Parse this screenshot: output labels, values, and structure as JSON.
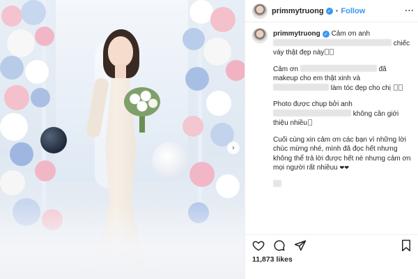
{
  "post": {
    "username": "primmytruong",
    "follow_label": "Follow",
    "dot": "•",
    "more": "···",
    "likes": "11,873 likes"
  },
  "caption": {
    "p1_a": "Cảm ơn anh",
    "p1_b": "chiếc váy thật đẹp này",
    "p2_a": "Cảm ơn",
    "p2_b": "đã makeup cho em thật xinh và",
    "p2_c": "làm tóc đẹp cho chị",
    "p3_a": "Photo được chụp bởi anh",
    "p3_b": "không cần giới thiệu nhiều",
    "p4": "Cuối cùng xin cảm ơn các bạn vì những lời chúc mừng nhé, mình đã đọc hết nhưng không thể trả lời được hết nè nhưng cảm ơn mọi người rất nhiềuu",
    "hearts": "❤❤"
  },
  "icons": {
    "verified": "verified-badge-icon",
    "like": "heart-icon",
    "comment": "comment-icon",
    "share": "share-icon",
    "save": "bookmark-icon",
    "carousel_next": "chevron-right-icon"
  },
  "colors": {
    "link_blue": "#3897f0",
    "text": "#262626",
    "muted": "#8e8e8e",
    "border": "#efefef"
  }
}
